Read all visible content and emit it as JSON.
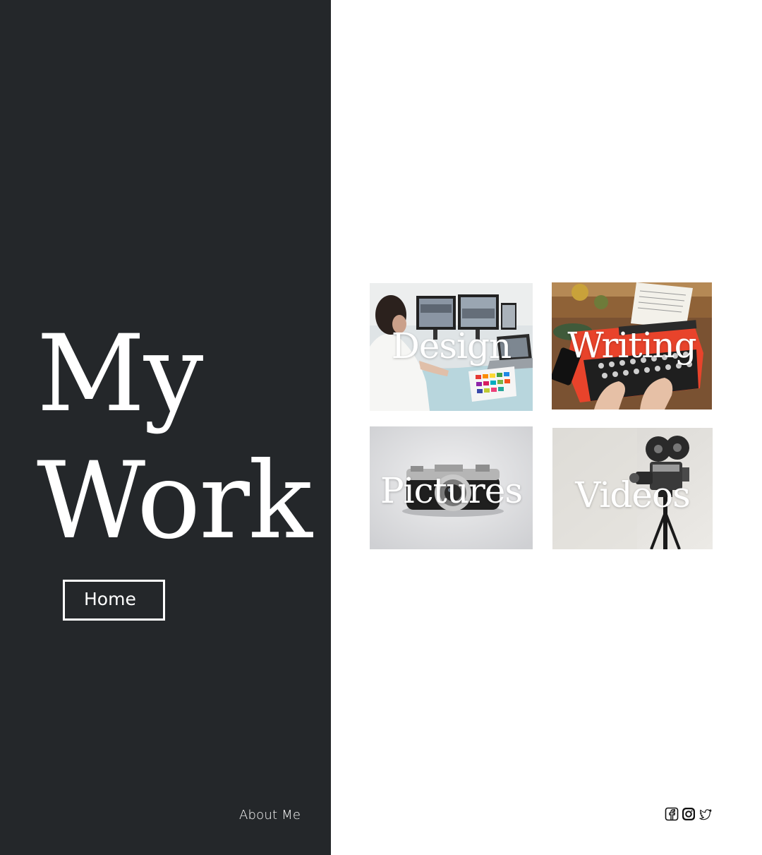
{
  "hero": {
    "line1": "My",
    "line2": "Work"
  },
  "nav": {
    "home_label": "Home",
    "about_label": "About Me"
  },
  "tiles": [
    {
      "label": "Design"
    },
    {
      "label": "Writing"
    },
    {
      "label": "Pictures"
    },
    {
      "label": "Videos"
    }
  ],
  "social": {
    "icons": [
      "facebook-icon",
      "instagram-icon",
      "twitter-icon"
    ]
  },
  "colors": {
    "left_panel": "#24272a",
    "page_background": "#ffffff",
    "text_on_dark": "#ffffff",
    "writing_accent": "#e8432b"
  }
}
